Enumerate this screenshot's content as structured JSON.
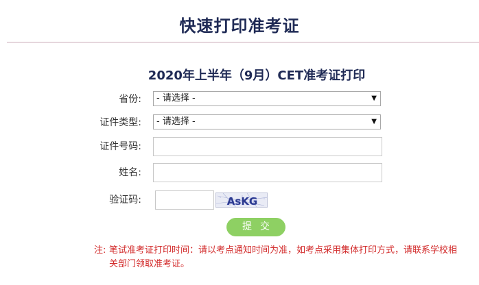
{
  "page": {
    "title": "快速打印准考证",
    "form_title": "2020年上半年（9月）CET准考证打印"
  },
  "form": {
    "province": {
      "label": "省份:",
      "selected": "- 请选择 -"
    },
    "id_type": {
      "label": "证件类型:",
      "selected": "- 请选择 -"
    },
    "id_number": {
      "label": "证件号码:",
      "value": ""
    },
    "name": {
      "label": "姓名:",
      "value": ""
    },
    "captcha": {
      "label": "验证码:",
      "value": "",
      "image_text": "AsKG"
    },
    "submit_label": "提交"
  },
  "note": {
    "label": "注:",
    "text": "笔试准考证打印时间：请以考点通知时间为准，如考点采用集体打印方式，请联系学校相关部门领取准考证。"
  },
  "colors": {
    "title": "#1f2a55",
    "submit": "#8ed063",
    "note": "#d22a2a",
    "divider": "#c9a7b6"
  }
}
